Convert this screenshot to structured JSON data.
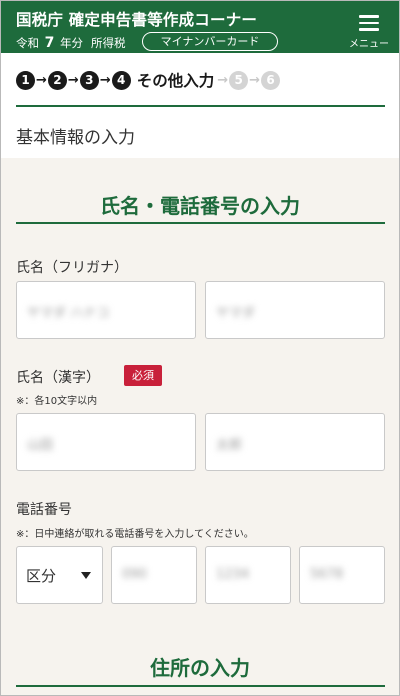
{
  "header": {
    "title": "国税庁 確定申告書等作成コーナー",
    "year_prefix": "令和",
    "year_number": "7",
    "year_suffix": "年分",
    "tax_kind": "所得税",
    "mynumber_button": "マイナンバーカード",
    "menu_label": "メニュー"
  },
  "steps": {
    "items": [
      "1",
      "2",
      "3",
      "4",
      "5",
      "6"
    ],
    "current_label": "その他入力",
    "arrow": "→"
  },
  "page_title": "基本情報の入力",
  "section_name_phone": {
    "title": "氏名・電話番号の入力",
    "kana": {
      "label": "氏名（フリガナ）",
      "last_value": "ヤマダ ハナコ",
      "first_value": "ヤマダ"
    },
    "kanji": {
      "label": "氏名（漢字）",
      "required_badge": "必須",
      "note": "※：各10文字以内",
      "last_value": "山田",
      "first_value": "太郎"
    },
    "phone": {
      "label": "電話番号",
      "note": "※：日中連絡が取れる電話番号を入力してください。",
      "type_select": "区分",
      "part1": "090",
      "part2": "1234",
      "part3": "5678"
    }
  },
  "section_address": {
    "title": "住所の入力"
  }
}
